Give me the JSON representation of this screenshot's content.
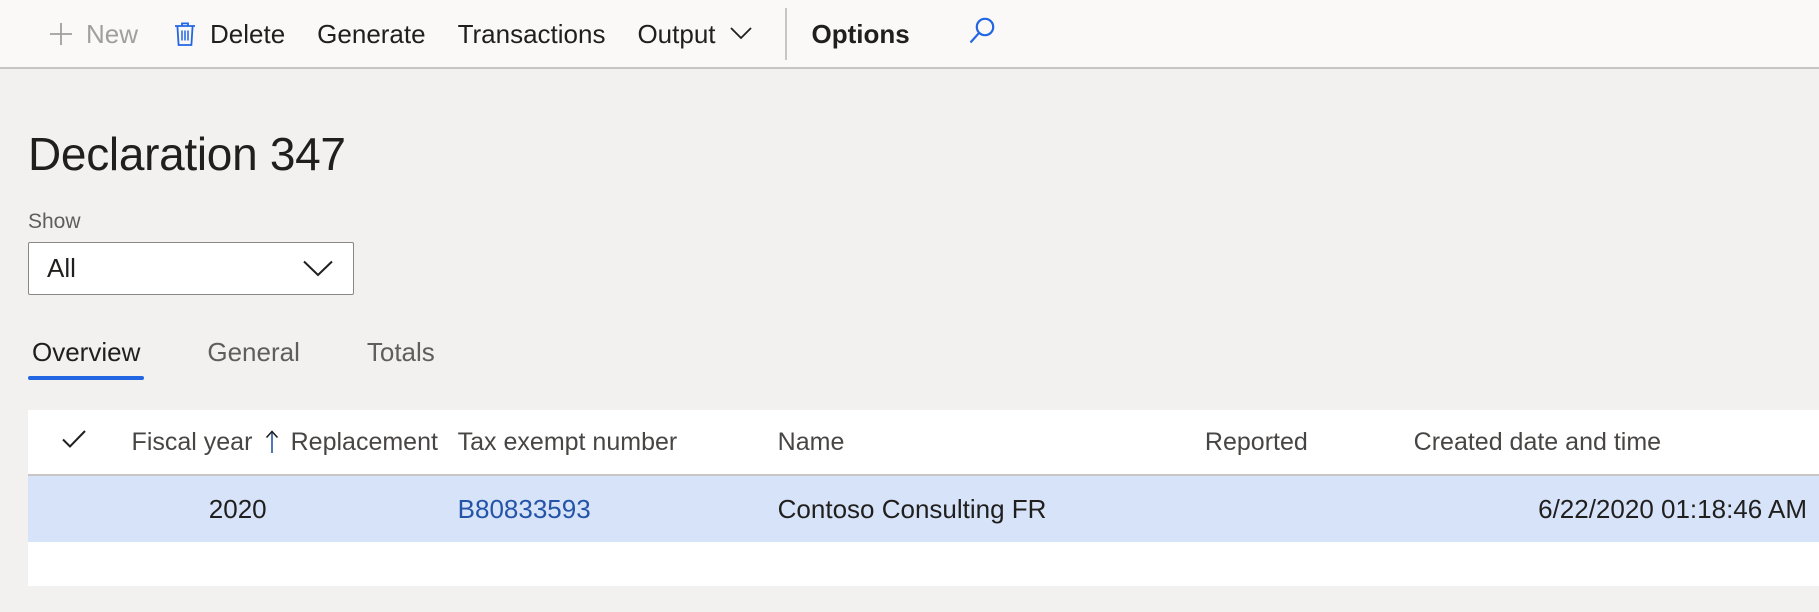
{
  "commandbar": {
    "items": [
      {
        "label": "New",
        "icon": "plus-icon",
        "disabled": true,
        "bold": false,
        "chevron": false
      },
      {
        "label": "Delete",
        "icon": "trash-icon",
        "disabled": false,
        "bold": false,
        "chevron": false
      },
      {
        "label": "Generate",
        "icon": "",
        "disabled": false,
        "bold": false,
        "chevron": false
      },
      {
        "label": "Transactions",
        "icon": "",
        "disabled": false,
        "bold": false,
        "chevron": false
      },
      {
        "label": "Output",
        "icon": "",
        "disabled": false,
        "bold": false,
        "chevron": true
      },
      {
        "label": "Options",
        "icon": "",
        "disabled": false,
        "bold": true,
        "chevron": false
      }
    ],
    "search_icon": "search-icon"
  },
  "page": {
    "title": "Declaration 347"
  },
  "filter": {
    "label": "Show",
    "value": "All",
    "chevron_icon": "chevron-down-icon"
  },
  "tabs": [
    {
      "label": "Overview",
      "active": true
    },
    {
      "label": "General",
      "active": false
    },
    {
      "label": "Totals",
      "active": false
    }
  ],
  "grid": {
    "select_all_icon": "checkmark-icon",
    "sort_icon": "sort-ascending-arrow-icon",
    "columns": [
      {
        "key": "fiscal_year",
        "label": "Fiscal year",
        "sorted": "ascending"
      },
      {
        "key": "replacement",
        "label": "Replacement",
        "sorted": ""
      },
      {
        "key": "tax_exempt",
        "label": "Tax exempt number",
        "sorted": ""
      },
      {
        "key": "name",
        "label": "Name",
        "sorted": ""
      },
      {
        "key": "reported",
        "label": "Reported",
        "sorted": ""
      },
      {
        "key": "created",
        "label": "Created date and time",
        "sorted": ""
      }
    ],
    "rows": [
      {
        "selected": true,
        "fiscal_year": "2020",
        "replacement": "",
        "tax_exempt": "B80833593",
        "name": "Contoso Consulting FR",
        "reported": "",
        "created": "6/22/2020 01:18:46 AM"
      }
    ]
  },
  "colors": {
    "accent": "#2266e3",
    "link": "#2454a8",
    "selected_row": "#d7e3f8",
    "commandbar_bg": "#faf9f8",
    "page_bg": "#f2f1f0"
  }
}
